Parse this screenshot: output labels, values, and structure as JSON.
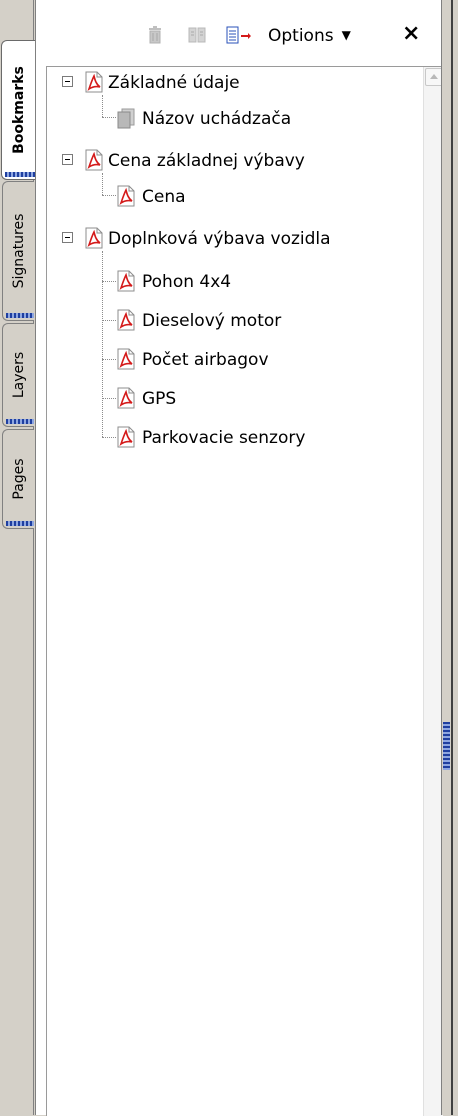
{
  "tabs": [
    {
      "label": "Bookmarks",
      "active": true
    },
    {
      "label": "Signatures",
      "active": false
    },
    {
      "label": "Layers",
      "active": false
    },
    {
      "label": "Pages",
      "active": false
    }
  ],
  "toolbar": {
    "icons": [
      "delete-icon",
      "bookmark-from-page-icon",
      "new-bookmark-icon"
    ],
    "options_label": "Options",
    "close_label": "×"
  },
  "tree": [
    {
      "label": "Základné údaje",
      "icon": "pdf-bookmark-icon",
      "expanded": true,
      "children": [
        {
          "label": "Názov uchádzača",
          "icon": "grey-bookmark-icon"
        }
      ]
    },
    {
      "label": "Cena základnej výbavy",
      "icon": "pdf-bookmark-icon",
      "expanded": true,
      "children": [
        {
          "label": "Cena",
          "icon": "pdf-bookmark-icon"
        }
      ]
    },
    {
      "label": "Doplnková výbava vozidla",
      "icon": "pdf-bookmark-icon",
      "expanded": true,
      "children": [
        {
          "label": "Pohon 4x4",
          "icon": "pdf-bookmark-icon"
        },
        {
          "label": "Dieselový motor",
          "icon": "pdf-bookmark-icon"
        },
        {
          "label": "Počet airbagov",
          "icon": "pdf-bookmark-icon"
        },
        {
          "label": "GPS",
          "icon": "pdf-bookmark-icon"
        },
        {
          "label": "Parkovacie senzory",
          "icon": "pdf-bookmark-icon"
        }
      ]
    }
  ],
  "colors": {
    "accent": "#1f3fa0",
    "pdf_red": "#d41a1a",
    "panel_bg": "#d4d0c8"
  }
}
